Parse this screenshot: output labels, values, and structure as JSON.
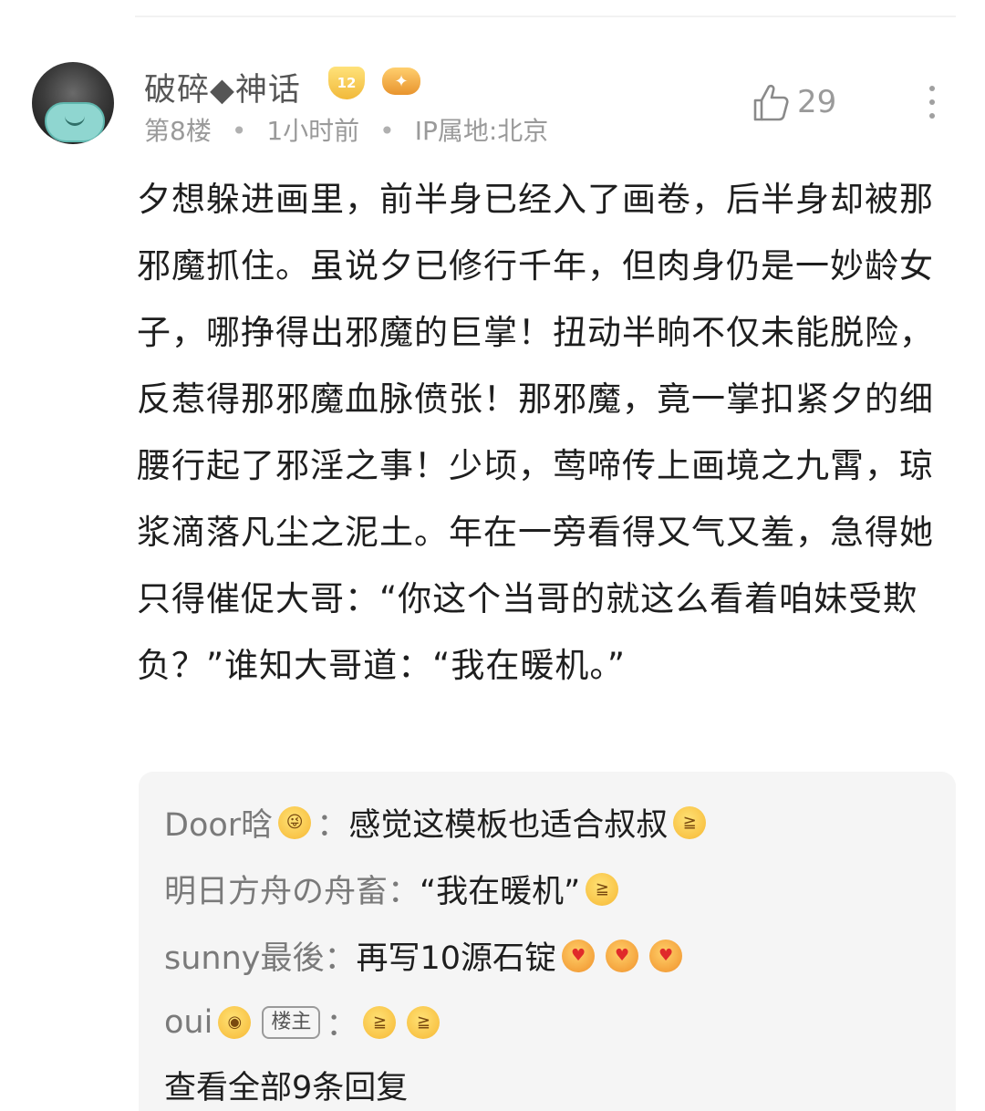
{
  "comment": {
    "username": "破碎◆神话",
    "level_badge": "12",
    "floor": "第8楼",
    "time": "1小时前",
    "ip": "IP属地:北京",
    "likes": "29",
    "body": "夕想躲进画里，前半身已经入了画卷，后半身却被那邪魔抓住。虽说夕已修行千年，但肉身仍是一妙龄女子，哪挣得出邪魔的巨掌！扭动半晌不仅未能脱险，反惹得那邪魔血脉偾张！那邪魔，竟一掌扣紧夕的细腰行起了邪淫之事！少顷，莺啼传上画境之九霄，琼浆滴落凡尘之泥土。年在一旁看得又气又羞，急得她只得催促大哥：“你这个当哥的就这么看着咱妹受欺负？”谁知大哥道：“我在暖机。”"
  },
  "replies": [
    {
      "author": "Door晗",
      "sep": "：",
      "text": "感觉这模板也适合叔叔"
    },
    {
      "author": "明日方舟の舟畜",
      "sep": "：",
      "text": "“我在暖机”"
    },
    {
      "author": "sunny最後",
      "sep": "：",
      "text": "再写10源石锭"
    },
    {
      "author": "oui",
      "tag": "楼主",
      "sep": "："
    }
  ],
  "view_all": "查看全部9条回复",
  "icons": [
    "like-icon",
    "more-icon",
    "level-badge-icon",
    "game-badge-icon"
  ]
}
